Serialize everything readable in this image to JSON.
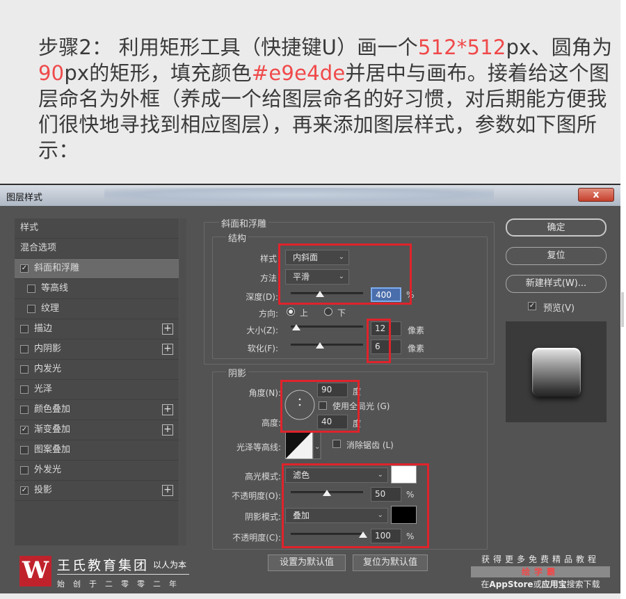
{
  "caption": {
    "part1": "步骤2： 利用矩形工具（快捷键U）画一个",
    "size": "512*512",
    "part2": "px、圆角为",
    "radius": "90",
    "part3": "px的矩形，填充颜色",
    "color": "#e9e4de",
    "part4": "并居中与画布。接着给这个图层命名为外框（养成一个给图层命名的好习惯，对后期能方便我们很快地寻找到相应图层），再来添加图层样式，参数如下图所示："
  },
  "dialog": {
    "title": "图层样式",
    "close": "x"
  },
  "style_list": {
    "header": "样式",
    "blend": "混合选项",
    "items": [
      {
        "label": "斜面和浮雕",
        "checked": true,
        "plus": false
      },
      {
        "label": "等高线",
        "checked": false,
        "plus": false
      },
      {
        "label": "纹理",
        "checked": false,
        "plus": false
      },
      {
        "label": "描边",
        "checked": false,
        "plus": true
      },
      {
        "label": "内阴影",
        "checked": false,
        "plus": true
      },
      {
        "label": "内发光",
        "checked": false,
        "plus": false
      },
      {
        "label": "光泽",
        "checked": false,
        "plus": false
      },
      {
        "label": "颜色叠加",
        "checked": false,
        "plus": true
      },
      {
        "label": "渐变叠加",
        "checked": true,
        "plus": true
      },
      {
        "label": "图案叠加",
        "checked": false,
        "plus": false
      },
      {
        "label": "外发光",
        "checked": false,
        "plus": false
      },
      {
        "label": "投影",
        "checked": true,
        "plus": true
      }
    ]
  },
  "bevel": {
    "group": "斜面和浮雕",
    "structure": "结构",
    "style_label": "样式",
    "style_value": "内斜面",
    "technique_label": "方法",
    "technique_value": "平滑",
    "depth_label": "深度(D):",
    "depth_value": "400",
    "depth_pct": 0.4,
    "depth_unit": "%",
    "direction_label": "方向:",
    "dir_up": "上",
    "dir_down": "下",
    "size_label": "大小(Z):",
    "size_value": "12",
    "size_pct": 0.08,
    "px1": "像素",
    "soften_label": "软化(F):",
    "soften_value": "6",
    "soften_pct": 0.4,
    "px2": "像素"
  },
  "shading": {
    "group": "阴影",
    "angle_label": "角度(N):",
    "angle_value": "90",
    "degree1": "度",
    "global_light": "使用全局光 (G)",
    "altitude_label": "高度:",
    "altitude_value": "40",
    "degree2": "度",
    "gloss_label": "光泽等高线:",
    "antialias": "消除锯齿 (L)",
    "highlight_label": "高光模式:",
    "highlight_mode": "滤色",
    "highlight_color": "#ffffff",
    "opacity1_label": "不透明度(O):",
    "opacity1_value": "50",
    "opacity1_pct": 0.5,
    "pct1": "%",
    "shadow_label": "阴影模式:",
    "shadow_mode": "叠加",
    "shadow_color": "#000000",
    "opacity2_label": "不透明度(C):",
    "opacity2_value": "100",
    "opacity2_pct": 1.0,
    "pct2": "%"
  },
  "bottom_buttons": {
    "set_default": "设置为默认值",
    "reset_default": "复位为默认值"
  },
  "right_buttons": {
    "ok": "确定",
    "reset": "复位",
    "new_style": "新建样式(W)...",
    "preview": "预览(V)"
  },
  "logo": {
    "mark": "W",
    "name": "王氏教育集团",
    "slogan": "以人为本",
    "sub": "始创于二零零二年"
  },
  "promo": {
    "top": "获得更多免费精品教程",
    "mid": "绘学霸",
    "bot_pre": "在",
    "bot_app": "AppStore",
    "bot_mid": "或",
    "bot_app2": "应用宝",
    "bot_post": "搜索下载"
  },
  "colors": {
    "highlight": "#f0494a",
    "dialog_bg": "#535353",
    "red_annotation": "#e0232b"
  }
}
